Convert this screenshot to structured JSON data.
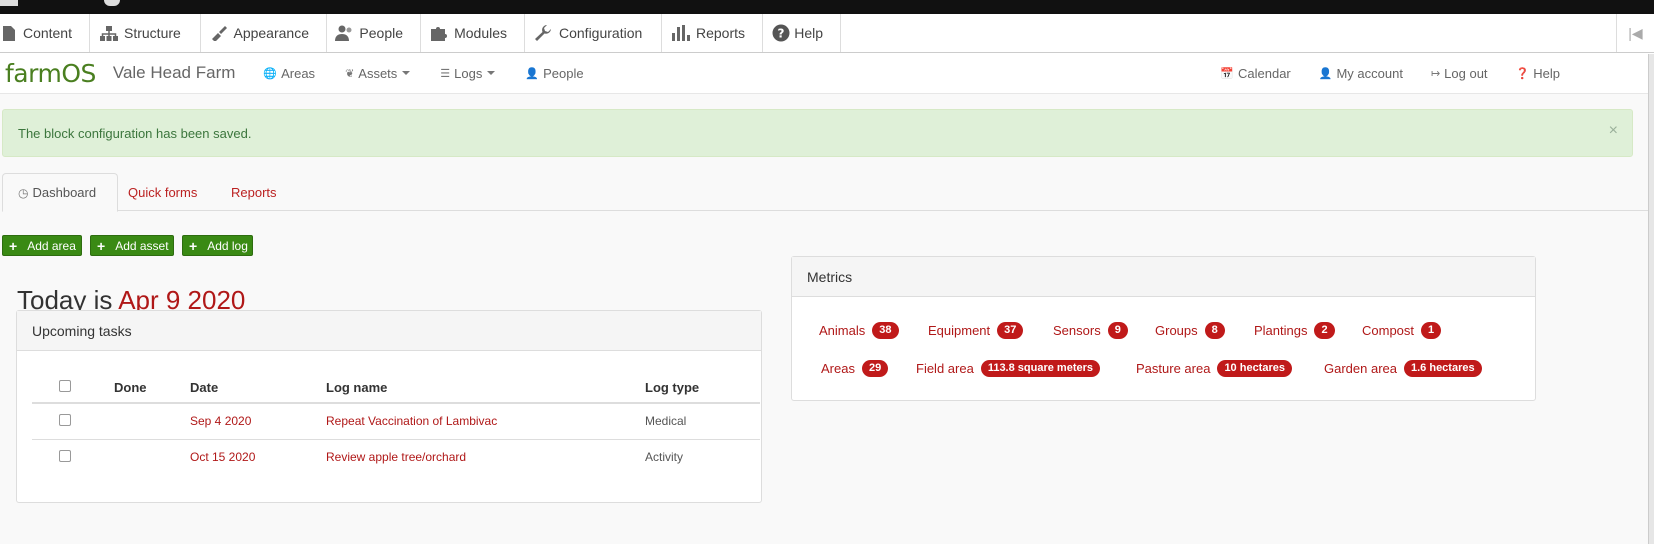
{
  "admin_toolbar": {
    "items": [
      {
        "label": "Content",
        "icon": "file-icon"
      },
      {
        "label": "Structure",
        "icon": "sitemap-icon"
      },
      {
        "label": "Appearance",
        "icon": "brush-icon"
      },
      {
        "label": "People",
        "icon": "people-icon"
      },
      {
        "label": "Modules",
        "icon": "puzzle-icon"
      },
      {
        "label": "Configuration",
        "icon": "wrench-icon"
      },
      {
        "label": "Reports",
        "icon": "bar-chart-icon"
      },
      {
        "label": "Help",
        "icon": "question-icon"
      }
    ]
  },
  "farm_nav": {
    "logo": "farmOS",
    "farm_name": "Vale Head Farm",
    "left": [
      {
        "label": "Areas",
        "icon": "globe-icon"
      },
      {
        "label": "Assets",
        "icon": "sprout-icon"
      },
      {
        "label": "Logs",
        "icon": "list-icon"
      },
      {
        "label": "People",
        "icon": "user-icon"
      }
    ],
    "right": [
      {
        "label": "Calendar",
        "icon": "calendar-icon"
      },
      {
        "label": "My account",
        "icon": "user-icon"
      },
      {
        "label": "Log out",
        "icon": "logout-icon"
      },
      {
        "label": "Help",
        "icon": "question-icon"
      }
    ]
  },
  "alert": {
    "message": "The block configuration has been saved.",
    "close": "×"
  },
  "tabs": [
    {
      "label": "Dashboard"
    },
    {
      "label": "Quick forms"
    },
    {
      "label": "Reports"
    }
  ],
  "actions": {
    "add_area": "Add area",
    "add_asset": "Add asset",
    "add_log": "Add log"
  },
  "today": {
    "prefix": "Today is",
    "date": "Apr 9 2020"
  },
  "upcoming": {
    "title": "Upcoming tasks",
    "columns": {
      "done": "Done",
      "date": "Date",
      "log_name": "Log name",
      "log_type": "Log type"
    },
    "rows": [
      {
        "date": "Sep 4 2020",
        "name": "Repeat Vaccination of Lambivac",
        "type": "Medical"
      },
      {
        "date": "Oct 15 2020",
        "name": "Review apple tree/orchard",
        "type": "Activity"
      }
    ]
  },
  "metrics": {
    "title": "Metrics",
    "items": [
      {
        "label": "Animals",
        "value": "38"
      },
      {
        "label": "Equipment",
        "value": "37"
      },
      {
        "label": "Sensors",
        "value": "9"
      },
      {
        "label": "Groups",
        "value": "8"
      },
      {
        "label": "Plantings",
        "value": "2"
      },
      {
        "label": "Compost",
        "value": "1"
      },
      {
        "label": "Areas",
        "value": "29"
      },
      {
        "label": "Field area",
        "value": "113.8 square meters"
      },
      {
        "label": "Pasture area",
        "value": "10 hectares"
      },
      {
        "label": "Garden area",
        "value": "1.6 hectares"
      }
    ]
  },
  "colors": {
    "accent": "#b01818",
    "brand_green": "#4a7f20",
    "button_green": "#3a8a14",
    "alert_bg": "#dff0d8"
  }
}
